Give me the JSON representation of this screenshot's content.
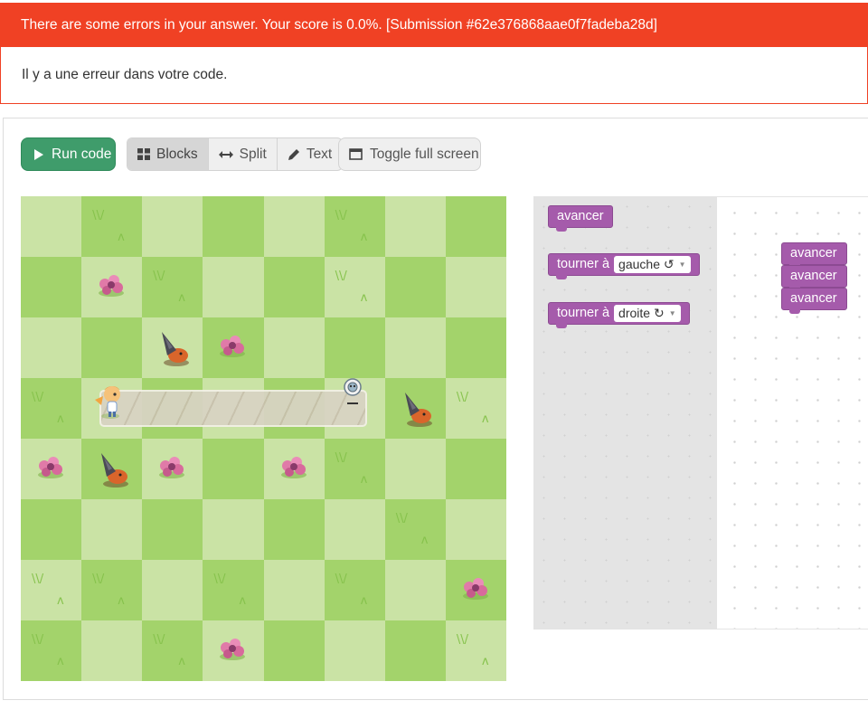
{
  "alert": {
    "title": "There are some errors in your answer. Your score is 0.0%. [Submission #62e376868aae0f7fadeba28d]",
    "message": "Il y a une erreur dans votre code."
  },
  "toolbar": {
    "run_label": "Run code",
    "blocks_label": "Blocks",
    "split_label": "Split",
    "text_label": "Text",
    "fullscreen_label": "Toggle full screen"
  },
  "toolbox": {
    "blocks": [
      {
        "label": "avancer"
      },
      {
        "label": "tourner à",
        "option": "gauche ↺"
      },
      {
        "label": "tourner à",
        "option": "droite ↻"
      }
    ]
  },
  "workspace": {
    "blocks": [
      "avancer",
      "avancer",
      "avancer"
    ]
  },
  "colors": {
    "alert": "#f04124",
    "run_button": "#3f9c6b",
    "block": "#a55bab",
    "grass_light": "#cae3a5",
    "grass_dark": "#a3d36b"
  },
  "icons": [
    "play-icon",
    "grid-icon",
    "arrows-horizontal-icon",
    "pencil-icon",
    "window-icon"
  ]
}
